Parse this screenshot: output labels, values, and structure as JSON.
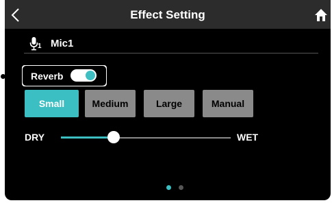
{
  "header": {
    "title": "Effect Setting",
    "back_icon": "chevron-left-icon",
    "home_icon": "home-icon"
  },
  "channel": {
    "icon": "microphone-icon",
    "number": "1",
    "name": "Mic1"
  },
  "effect": {
    "label": "Reverb",
    "enabled": true
  },
  "reverb_types": [
    {
      "label": "Small",
      "selected": true
    },
    {
      "label": "Medium",
      "selected": false
    },
    {
      "label": "Large",
      "selected": false
    },
    {
      "label": "Manual",
      "selected": false
    }
  ],
  "mix": {
    "left_label": "DRY",
    "right_label": "WET",
    "value": 0.31
  },
  "pagination": {
    "current": 1,
    "total": 2
  },
  "colors": {
    "accent": "#3bbfc2",
    "button_inactive": "#8a8a8a",
    "header": "#2c2c2c"
  }
}
